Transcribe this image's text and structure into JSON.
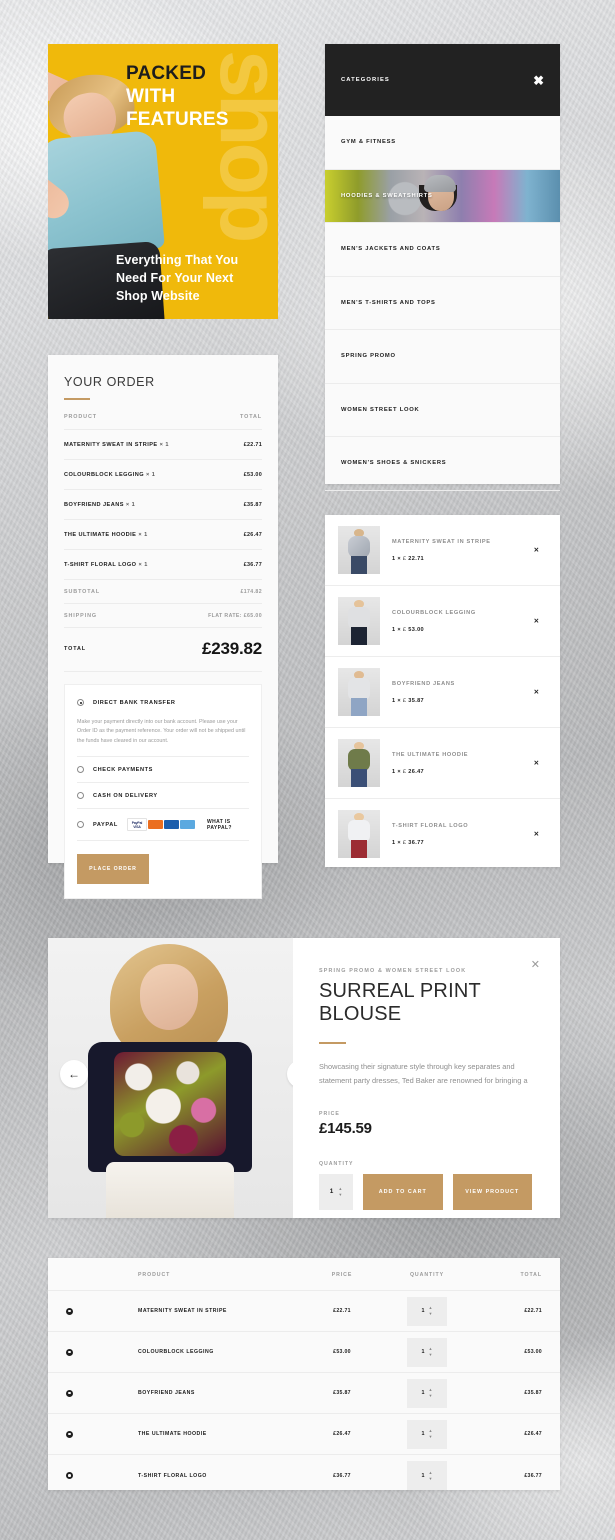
{
  "hero": {
    "line1": "PACKED",
    "line2": "WITH",
    "line3": "FEATURES",
    "ghost": "shop",
    "subtitle": "Everything That You Need For Your Next Shop Website"
  },
  "order": {
    "title": "YOUR ORDER",
    "col_product": "PRODUCT",
    "col_total": "TOTAL",
    "items": [
      {
        "name": "MATERNITY SWEAT IN STRIPE",
        "qty": "× 1",
        "total": "£22.71"
      },
      {
        "name": "COLOURBLOCK LEGGING",
        "qty": "× 1",
        "total": "£53.00"
      },
      {
        "name": "BOYFRIEND JEANS",
        "qty": "× 1",
        "total": "£35.87"
      },
      {
        "name": "THE ULTIMATE HOODIE",
        "qty": "× 1",
        "total": "£26.47"
      },
      {
        "name": "T-SHIRT FLORAL LOGO",
        "qty": "× 1",
        "total": "£36.77"
      }
    ],
    "subtotal_label": "SUBTOTAL",
    "subtotal_value": "£174.82",
    "shipping_label": "SHIPPING",
    "shipping_value": "FLAT RATE: £65.00",
    "total_label": "TOTAL",
    "total_value": "£239.82",
    "payment": {
      "bank_label": "DIRECT BANK TRANSFER",
      "bank_desc": "Make your payment directly into our bank account. Please use your Order ID as the payment reference. Your order will not be shipped until the funds have cleared in our account.",
      "check_label": "CHECK PAYMENTS",
      "cod_label": "CASH ON DELIVERY",
      "paypal_label": "PAYPAL",
      "paypal_what": "WHAT IS PAYPAL?",
      "badges": [
        "PayPal",
        "VISA",
        "MC",
        "MC2",
        "AE"
      ]
    },
    "place_order": "PLACE ORDER"
  },
  "categories": {
    "heading": "CATEGORIES",
    "close_icon": "✖",
    "items": [
      {
        "label": "GYM & FITNESS",
        "active": false
      },
      {
        "label": "HOODIES & SWEATSHIRTS",
        "active": true
      },
      {
        "label": "MEN'S JACKETS AND COATS",
        "active": false
      },
      {
        "label": "MEN'S T-SHIRTS AND TOPS",
        "active": false
      },
      {
        "label": "SPRING PROMO",
        "active": false
      },
      {
        "label": "WOMEN STREET LOOK",
        "active": false
      },
      {
        "label": "WOMEN'S SHOES & SNICKERS",
        "active": false
      }
    ]
  },
  "minicart": {
    "remove_icon": "✕",
    "items": [
      {
        "name": "MATERNITY SWEAT IN STRIPE",
        "qty": "1 ×",
        "currency": "£",
        "price": "22.71"
      },
      {
        "name": "COLOURBLOCK LEGGING",
        "qty": "1 ×",
        "currency": "£",
        "price": "53.00"
      },
      {
        "name": "BOYFRIEND JEANS",
        "qty": "1 ×",
        "currency": "£",
        "price": "35.87"
      },
      {
        "name": "THE ULTIMATE HOODIE",
        "qty": "1 ×",
        "currency": "£",
        "price": "26.47"
      },
      {
        "name": "T-SHIRT FLORAL LOGO",
        "qty": "1 ×",
        "currency": "£",
        "price": "36.77"
      }
    ]
  },
  "quickview": {
    "breadcrumb": "SPRING PROMO & WOMEN STREET LOOK",
    "title": "SURREAL PRINT BLOUSE",
    "description": "Showcasing their signature style through key separates and statement party dresses, Ted Baker are renowned for bringing a",
    "price_label": "PRICE",
    "price": "£145.59",
    "quantity_label": "QUANTITY",
    "quantity_value": "1",
    "add_to_cart": "ADD TO CART",
    "view_product": "VIEW PRODUCT",
    "close_icon": "✕",
    "prev_icon": "←",
    "next_icon": "→"
  },
  "carttable": {
    "columns": {
      "product": "PRODUCT",
      "price": "PRICE",
      "quantity": "QUANTITY",
      "total": "TOTAL"
    },
    "rows": [
      {
        "name": "MATERNITY SWEAT IN STRIPE",
        "price": "£22.71",
        "qty": "1",
        "total": "£22.71"
      },
      {
        "name": "COLOURBLOCK LEGGING",
        "price": "£53.00",
        "qty": "1",
        "total": "£53.00"
      },
      {
        "name": "BOYFRIEND JEANS",
        "price": "£35.87",
        "qty": "1",
        "total": "£35.87"
      },
      {
        "name": "THE ULTIMATE HOODIE",
        "price": "£26.47",
        "qty": "1",
        "total": "£26.47"
      },
      {
        "name": "T-SHIRT FLORAL LOGO",
        "price": "£36.77",
        "qty": "1",
        "total": "£36.77"
      }
    ]
  },
  "colors": {
    "accent_gold": "#c49a63",
    "hero_yellow": "#f0b90b",
    "header_dark": "#222222"
  }
}
